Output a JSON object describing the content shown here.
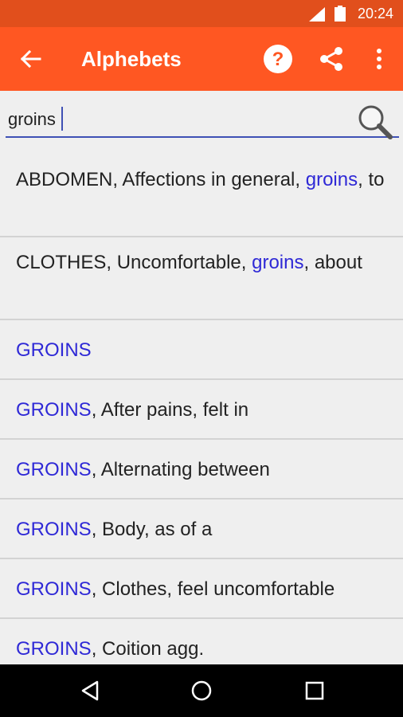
{
  "status_bar": {
    "time": "20:24"
  },
  "app_bar": {
    "title": "Alphebets"
  },
  "search": {
    "value": "groins"
  },
  "results": [
    {
      "pre": "ABDOMEN, Affections in general, ",
      "hl": "groins",
      "post": ", to"
    },
    {
      "pre": "CLOTHES, Uncomfortable, ",
      "hl": "groins",
      "post": ", about"
    },
    {
      "pre": "",
      "hl": "GROINS",
      "post": ""
    },
    {
      "pre": "",
      "hl": "GROINS",
      "post": ", After pains, felt in"
    },
    {
      "pre": "",
      "hl": "GROINS",
      "post": ", Alternating between"
    },
    {
      "pre": "",
      "hl": "GROINS",
      "post": ", Body, as of a"
    },
    {
      "pre": "",
      "hl": "GROINS",
      "post": ", Clothes, feel uncomfortable"
    },
    {
      "pre": "",
      "hl": "GROINS",
      "post": ", Coition agg."
    }
  ],
  "colors": {
    "primary": "#ff5722",
    "status_bar": "#e14f1c",
    "highlight": "#2f29d6",
    "accent": "#3f51b5"
  },
  "icons": [
    "back-arrow-icon",
    "help-icon",
    "share-icon",
    "more-vert-icon",
    "search-icon",
    "nav-back-icon",
    "nav-home-icon",
    "nav-recents-icon"
  ]
}
